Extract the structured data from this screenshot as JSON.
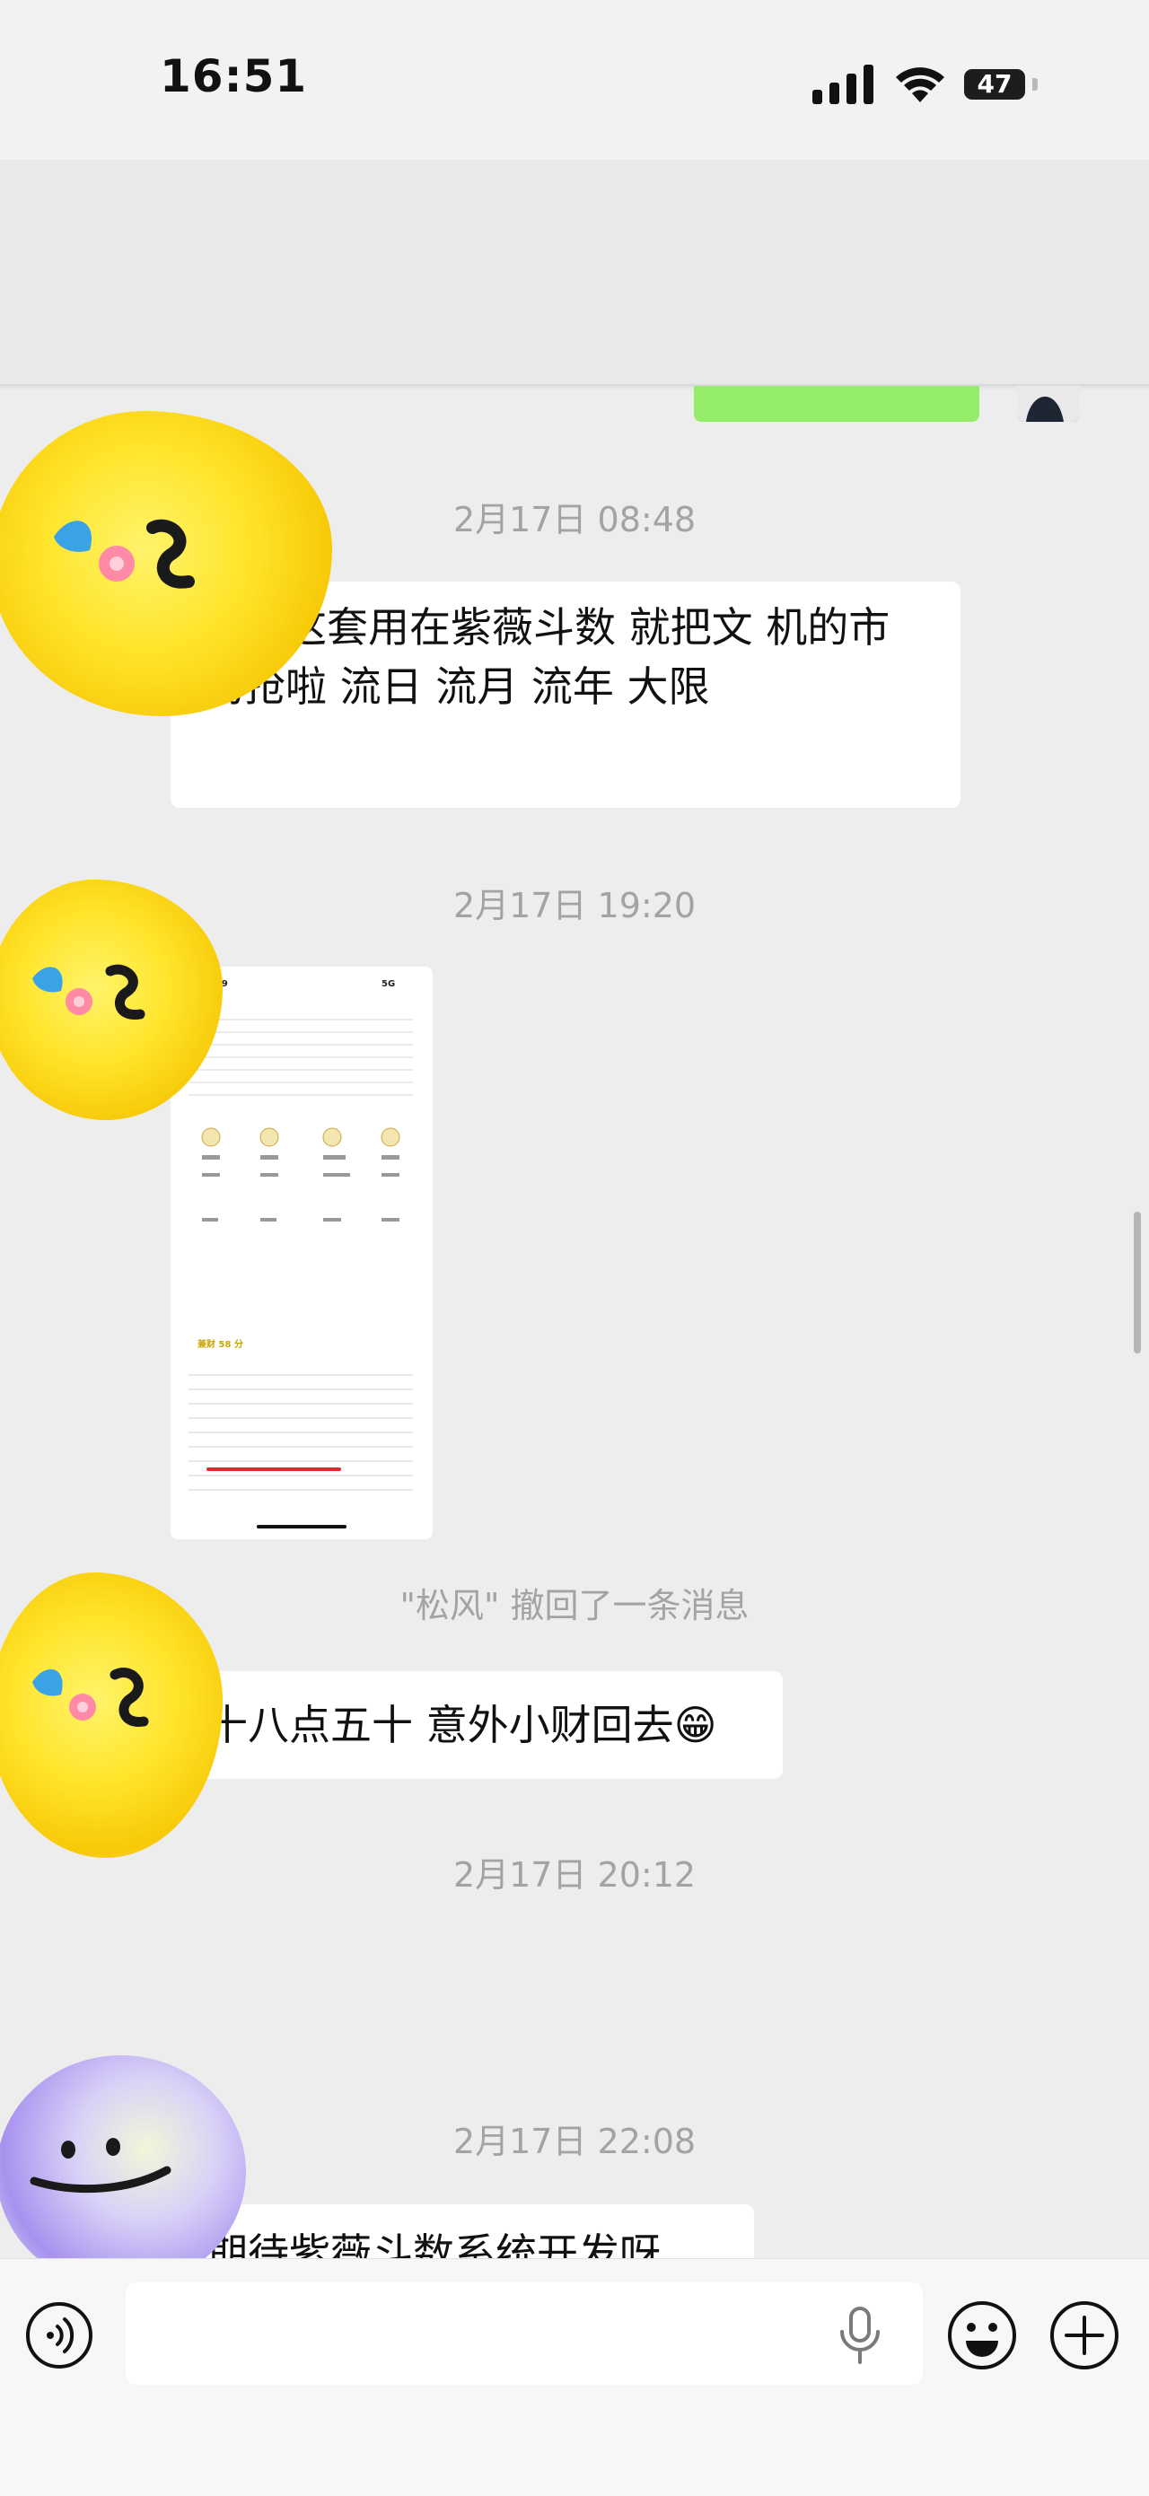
{
  "status_bar": {
    "time": "16:51",
    "battery": "47"
  },
  "messages": {
    "ts_1": "2月17日 08:48",
    "msg_1": "如果这套用在紫薇斗数 就把文 机的市场抢啦 流日 流月 流年 大限",
    "ts_2": "2月17日 19:20",
    "thumb": {
      "time": "19:19",
      "status": "5G",
      "line1": "甲戌",
      "line2": "旺",
      "line3": "兼财 58 分",
      "line4": "忌事",
      "line5": "命理逻辑"
    },
    "recall": "\"松风\" 撤回了一条消息",
    "msg_3": "十八点五十 意外小财回去😁",
    "ts_3": "2月17日 20:12",
    "ts_4": "2月17日 22:08",
    "msg_4": "期待紫薇斗数系统开发呀"
  },
  "input": {
    "placeholder": ""
  }
}
